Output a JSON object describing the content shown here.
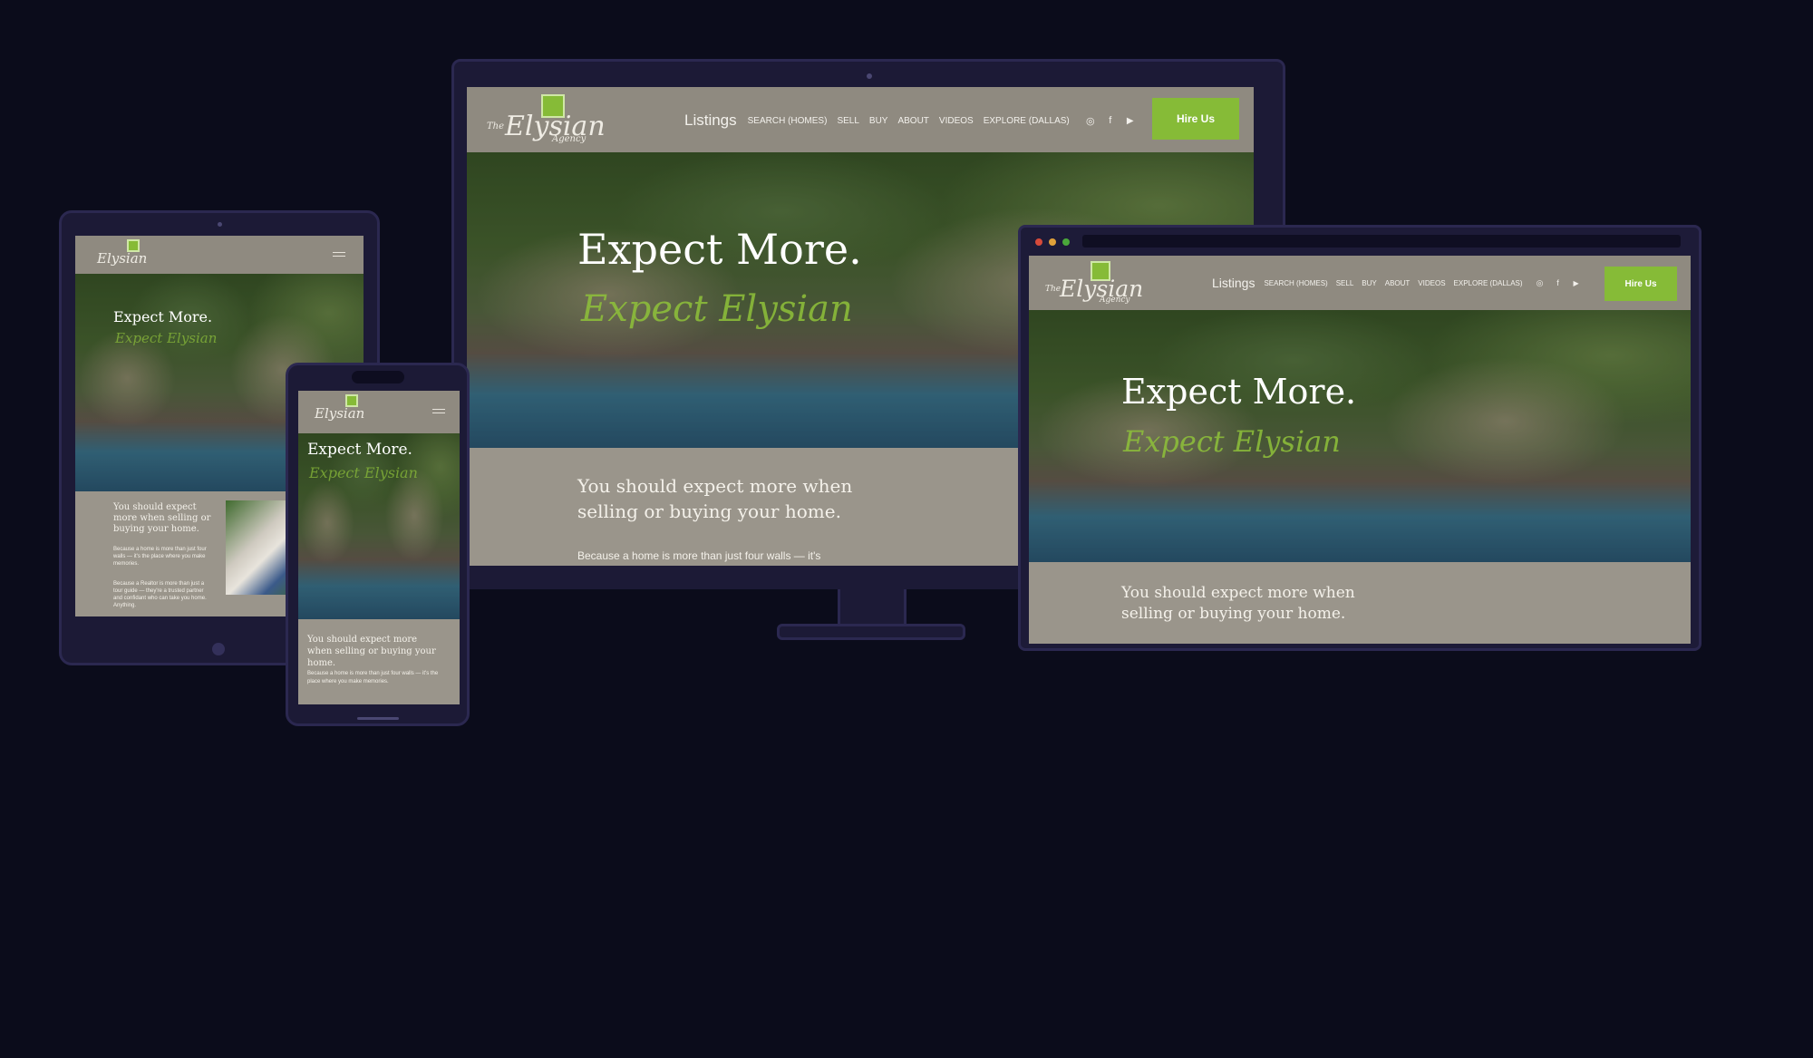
{
  "brand": {
    "logo_the": "The",
    "logo_name": "Elysian",
    "logo_agency": "Agency",
    "accent_color": "#86bb37"
  },
  "nav": {
    "listings": "Listings",
    "search": "SEARCH (HOMES)",
    "sell": "SELL",
    "buy": "BUY",
    "about": "ABOUT",
    "videos": "VIDEOS",
    "explore": "EXPLORE (DALLAS)",
    "hire": "Hire Us",
    "social_icons": [
      "instagram-icon",
      "facebook-icon",
      "youtube-icon"
    ]
  },
  "hero": {
    "headline": "Expect More.",
    "script": "Expect Elysian"
  },
  "content": {
    "intro_line1": "You should expect more when",
    "intro_line2": "selling or buying your home.",
    "intro_full": "You should expect more when selling or buying your home.",
    "para_desktop": "Because a home is more than just four walls — it's",
    "para_phone": "Because a home is more than just four walls — it's the place where you make memories.",
    "para_tablet1": "Because a home is more than just four walls — it's the place where you make memories.",
    "para_tablet2": "Because a Realtor is more than just a tour guide — they're a trusted partner and confidant who can take you home. Anything."
  }
}
